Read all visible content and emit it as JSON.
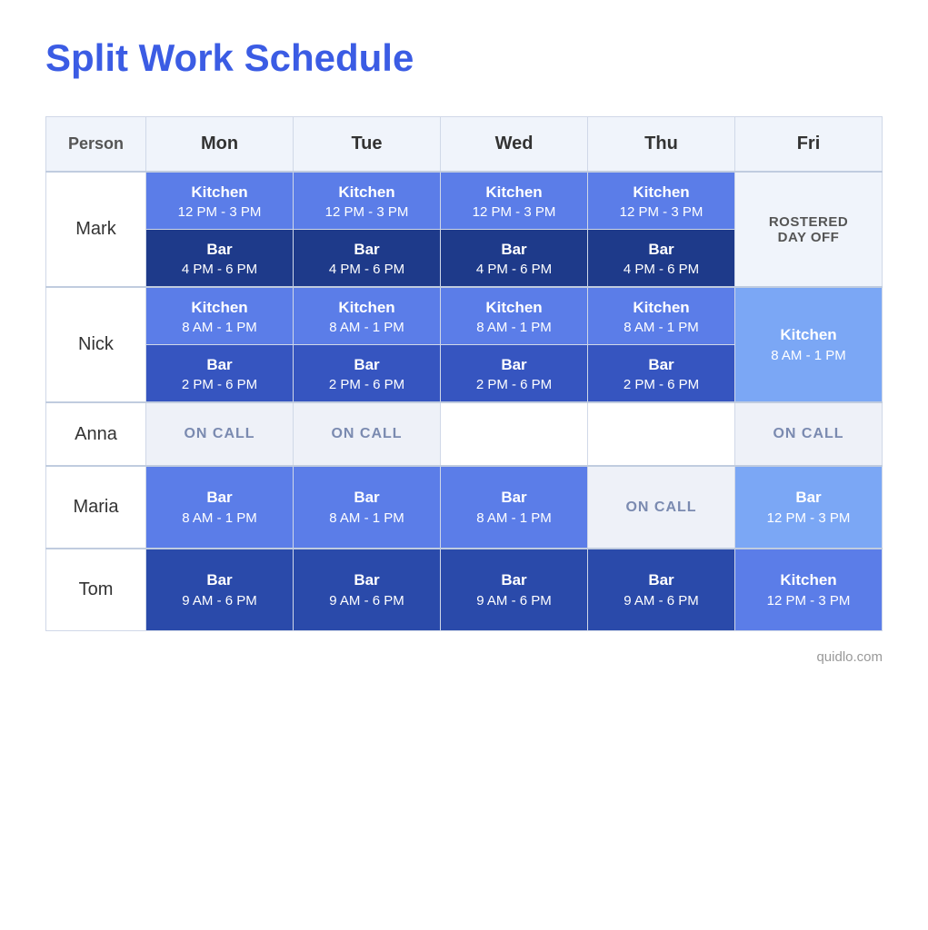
{
  "title": "Split Work Schedule",
  "footer": "quidlo.com",
  "headers": {
    "person": "Person",
    "mon": "Mon",
    "tue": "Tue",
    "wed": "Wed",
    "thu": "Thu",
    "fri": "Fri"
  },
  "rows": [
    {
      "person": "Mark",
      "mon": {
        "top_name": "Kitchen",
        "top_time": "12 PM - 3 PM",
        "bot_name": "Bar",
        "bot_time": "4 PM  - 6 PM"
      },
      "tue": {
        "top_name": "Kitchen",
        "top_time": "12 PM - 3 PM",
        "bot_name": "Bar",
        "bot_time": "4 PM  - 6 PM"
      },
      "wed": {
        "top_name": "Kitchen",
        "top_time": "12 PM - 3 PM",
        "bot_name": "Bar",
        "bot_time": "4 PM  - 6 PM"
      },
      "thu": {
        "top_name": "Kitchen",
        "top_time": "12 PM - 3 PM",
        "bot_name": "Bar",
        "bot_time": "4 PM  - 6 PM"
      },
      "fri": "ROSTERED DAY OFF"
    },
    {
      "person": "Nick",
      "mon": {
        "top_name": "Kitchen",
        "top_time": "8 AM - 1 PM",
        "bot_name": "Bar",
        "bot_time": "2 PM  - 6 PM"
      },
      "tue": {
        "top_name": "Kitchen",
        "top_time": "8 AM - 1 PM",
        "bot_name": "Bar",
        "bot_time": "2 PM  - 6 PM"
      },
      "wed": {
        "top_name": "Kitchen",
        "top_time": "8 AM - 1 PM",
        "bot_name": "Bar",
        "bot_time": "2 PM  - 6 PM"
      },
      "thu": {
        "top_name": "Kitchen",
        "top_time": "8 AM - 1 PM",
        "bot_name": "Bar",
        "bot_time": "2 PM  - 6 PM"
      },
      "fri": {
        "single_name": "Kitchen",
        "single_time": "8 AM - 1 PM"
      }
    },
    {
      "person": "Anna",
      "mon": "ON CALL",
      "tue": "ON CALL",
      "wed": "",
      "thu": "",
      "fri": "ON CALL"
    },
    {
      "person": "Maria",
      "mon": {
        "single_name": "Bar",
        "single_time": "8 AM  - 1 PM"
      },
      "tue": {
        "single_name": "Bar",
        "single_time": "8 AM  - 1 PM"
      },
      "wed": {
        "single_name": "Bar",
        "single_time": "8 AM  - 1 PM"
      },
      "thu": "ON CALL",
      "fri": {
        "single_name": "Bar",
        "single_time": "12 PM - 3 PM"
      }
    },
    {
      "person": "Tom",
      "mon": {
        "single_name": "Bar",
        "single_time": "9 AM  - 6 PM"
      },
      "tue": {
        "single_name": "Bar",
        "single_time": "9 AM  - 6 PM"
      },
      "wed": {
        "single_name": "Bar",
        "single_time": "9 AM  - 6 PM"
      },
      "thu": {
        "single_name": "Bar",
        "single_time": "9 AM  - 6 PM"
      },
      "fri": {
        "single_name": "Kitchen",
        "single_time": "12 PM  - 3 PM"
      }
    }
  ]
}
